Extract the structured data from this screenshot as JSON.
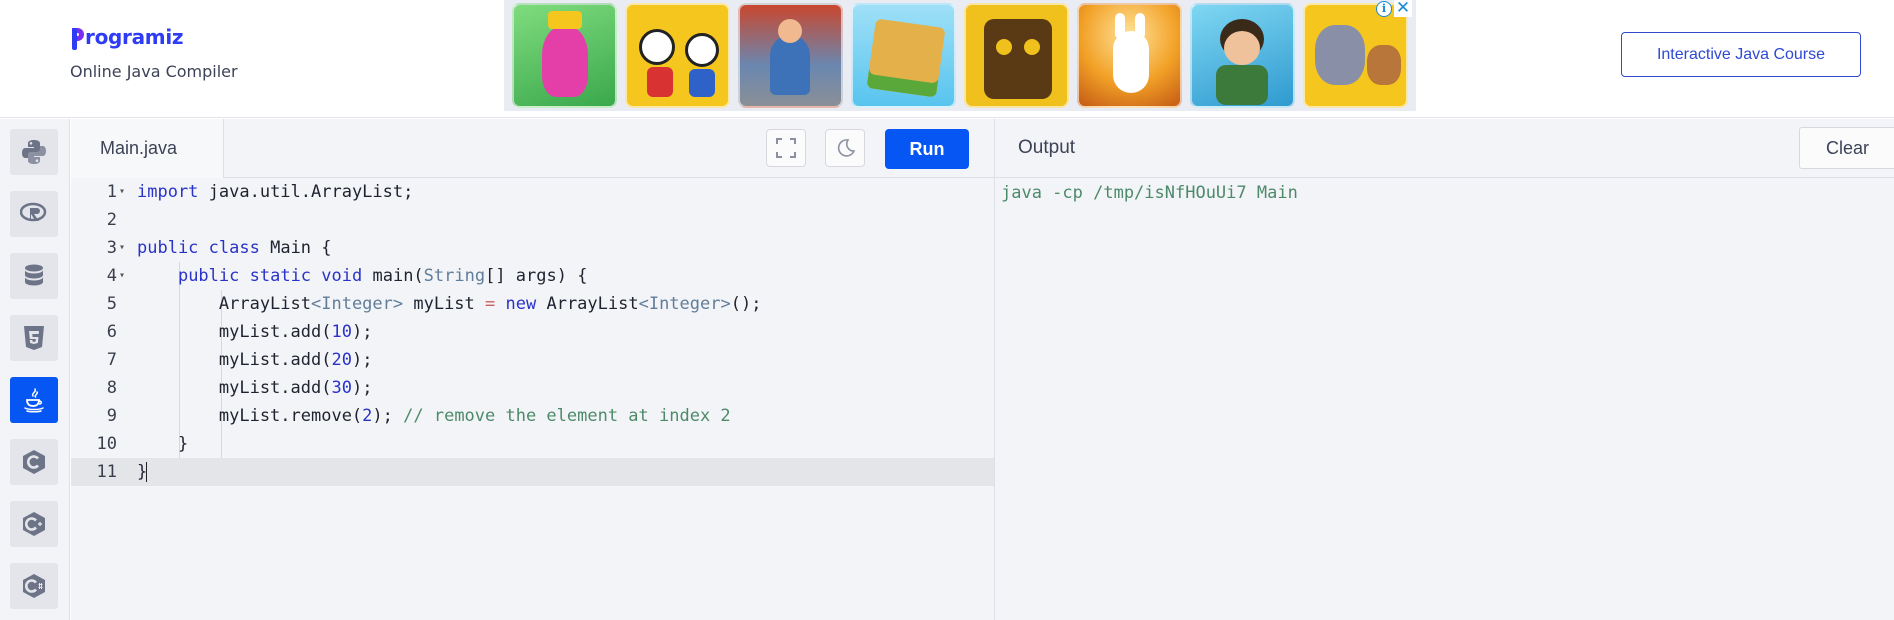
{
  "header": {
    "logo_text": "rogramiz",
    "subtitle": "Online Java Compiler",
    "course_button": "Interactive Java Course"
  },
  "ad": {
    "info_glyph": "i",
    "close_glyph": "✕",
    "tiles": [
      {
        "name": "ad-tile-pink-character",
        "colors": [
          "#5cc86a",
          "#e43fa8"
        ]
      },
      {
        "name": "ad-tile-cartoon-cups",
        "colors": [
          "#f5c61d",
          "#d93232"
        ]
      },
      {
        "name": "ad-tile-runner",
        "colors": [
          "#c9472f",
          "#3e72b8"
        ]
      },
      {
        "name": "ad-tile-block",
        "colors": [
          "#58c4ee",
          "#e3b04a"
        ]
      },
      {
        "name": "ad-tile-temple",
        "colors": [
          "#f0c11c",
          "#5a3a15"
        ]
      },
      {
        "name": "ad-tile-rabbit",
        "colors": [
          "#f2a127",
          "#ffffff"
        ]
      },
      {
        "name": "ad-tile-boy",
        "colors": [
          "#4cb9e6",
          "#3c7a3c"
        ]
      },
      {
        "name": "ad-tile-cat-mouse",
        "colors": [
          "#f5c61d",
          "#8a8fa8"
        ]
      }
    ]
  },
  "sidebar": {
    "languages": [
      {
        "name": "python",
        "icon": "python-icon",
        "active": false
      },
      {
        "name": "r",
        "icon": "r-icon",
        "active": false
      },
      {
        "name": "sql",
        "icon": "database-icon",
        "active": false
      },
      {
        "name": "html",
        "icon": "html5-icon",
        "active": false
      },
      {
        "name": "java",
        "icon": "java-icon",
        "active": true
      },
      {
        "name": "c",
        "icon": "c-icon",
        "active": false
      },
      {
        "name": "cpp",
        "icon": "cpp-icon",
        "active": false
      },
      {
        "name": "csharp",
        "icon": "csharp-icon",
        "active": false
      }
    ]
  },
  "editor": {
    "file_tab": "Main.java",
    "run_label": "Run",
    "line_numbers": [
      "1",
      "2",
      "3",
      "4",
      "5",
      "6",
      "7",
      "8",
      "9",
      "10",
      "11"
    ],
    "current_line": 11
  },
  "output": {
    "title": "Output",
    "clear_label": "Clear",
    "text": "java -cp /tmp/isNfHOuUi7 Main"
  },
  "colors": {
    "accent": "#0556f3",
    "brand": "#2f3cf5",
    "keyword": "#2a33c8",
    "type": "#607d9a",
    "comment": "#4d8a6a"
  }
}
